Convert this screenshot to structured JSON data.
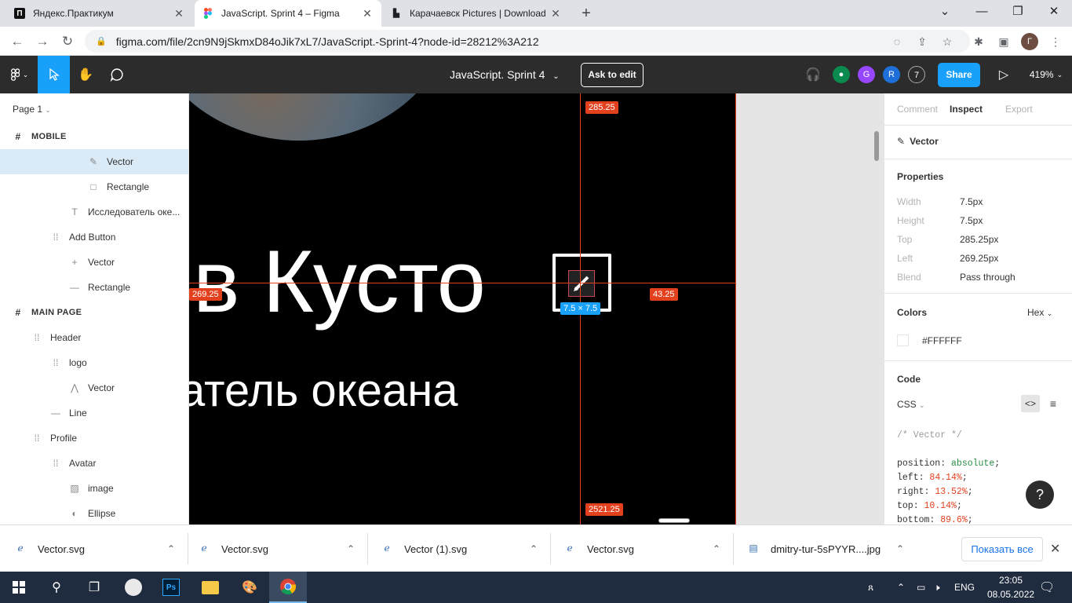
{
  "browser": {
    "tabs": [
      {
        "title": "Яндекс.Практикум",
        "favicon": "П"
      },
      {
        "title": "JavaScript. Sprint 4 – Figma",
        "favicon": "F"
      },
      {
        "title": "Карачаевск Pictures | Download",
        "favicon": "▙"
      }
    ],
    "url": "figma.com/file/2cn9N9jSkmxD84oJik7xL7/JavaScript.-Sprint-4?node-id=28212%3A212",
    "profile_initial": "Г"
  },
  "figma": {
    "doc_title": "JavaScript. Sprint 4",
    "ask_to_edit": "Ask to edit",
    "avatars": [
      "G",
      "R"
    ],
    "viewer_count": "7",
    "share": "Share",
    "zoom": "419%"
  },
  "layers": {
    "page": "Page 1",
    "items": [
      {
        "label": "MOBILE",
        "icon": "#",
        "section": true
      },
      {
        "label": "Vector",
        "icon": "✎",
        "selected": true
      },
      {
        "label": "Rectangle",
        "icon": "□"
      },
      {
        "label": "Исследователь оке...",
        "icon": "T"
      },
      {
        "label": "Add Button",
        "icon": "⁞⁞"
      },
      {
        "label": "Vector",
        "icon": "+"
      },
      {
        "label": "Rectangle",
        "icon": "—"
      },
      {
        "label": "MAIN PAGE",
        "icon": "#",
        "section": true
      },
      {
        "label": "Header",
        "icon": "⁞⁞"
      },
      {
        "label": "logo",
        "icon": "⁞⁞"
      },
      {
        "label": "Vector",
        "icon": "⋀"
      },
      {
        "label": "Line",
        "icon": "—"
      },
      {
        "label": "Profile",
        "icon": "⁞⁞"
      },
      {
        "label": "Avatar",
        "icon": "⁞⁞"
      },
      {
        "label": "image",
        "icon": "▨"
      },
      {
        "label": "Ellipse",
        "icon": "◐"
      }
    ]
  },
  "canvas": {
    "title_text": "в Кусто",
    "subtitle_text": "атель океана",
    "measure_top": "285.25",
    "measure_left": "269.25",
    "measure_right": "43.25",
    "measure_bottom": "2521.25",
    "size_label": "7.5 × 7.5"
  },
  "inspect": {
    "tabs": [
      "Comment",
      "Inspect",
      "Export"
    ],
    "layer_name": "Vector",
    "properties_title": "Properties",
    "props": [
      {
        "label": "Width",
        "value": "7.5px"
      },
      {
        "label": "Height",
        "value": "7.5px"
      },
      {
        "label": "Top",
        "value": "285.25px"
      },
      {
        "label": "Left",
        "value": "269.25px"
      },
      {
        "label": "Blend",
        "value": "Pass through"
      }
    ],
    "colors_title": "Colors",
    "color_format": "Hex",
    "color_value": "#FFFFFF",
    "code_title": "Code",
    "code_lang": "CSS",
    "code_comment": "/* Vector */",
    "code_lines": [
      {
        "prop": "position: ",
        "val": "absolute",
        "type": "kw"
      },
      {
        "prop": "left: ",
        "val": "84.14%",
        "type": "num"
      },
      {
        "prop": "right: ",
        "val": "13.52%",
        "type": "num"
      },
      {
        "prop": "top: ",
        "val": "10.14%",
        "type": "num"
      },
      {
        "prop": "bottom: ",
        "val": "89.6%",
        "type": "num"
      }
    ],
    "help": "?"
  },
  "downloads": {
    "items": [
      "Vector.svg",
      "Vector.svg",
      "Vector (1).svg",
      "Vector.svg",
      "dmitry-tur-5sPYYR....jpg"
    ],
    "show_all": "Показать все"
  },
  "taskbar": {
    "lang": "ENG",
    "time": "23:05",
    "date": "08.05.2022"
  },
  "colors": {
    "figma_blue": "#18a0fb",
    "measure_red": "#e3411e",
    "toolbar_dark": "#2c2c2c"
  }
}
